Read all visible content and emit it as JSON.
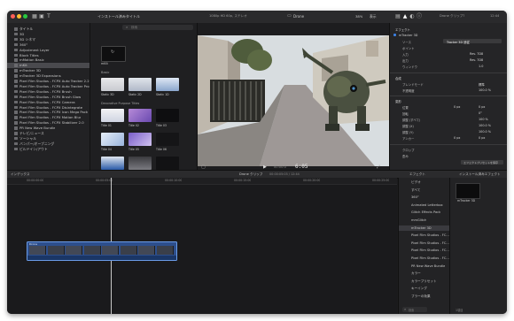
{
  "toolbar": {
    "title_center": "インストール済みタイトル",
    "viewer_info": "1080p HD 60p, ステレオ",
    "viewer_name": "Drone",
    "zoom": "38%",
    "display": "表示",
    "inspector_title": "Drone クリップ?",
    "inspector_duration": "12:44"
  },
  "sidebar": {
    "items": [
      {
        "label": "タイトル",
        "selected": false
      },
      {
        "label": "3D",
        "selected": false
      },
      {
        "label": "3D シネマ",
        "selected": false
      },
      {
        "label": "360°",
        "selected": false
      },
      {
        "label": "Adjustment Layer",
        "selected": false
      },
      {
        "label": "Block Titles",
        "selected": false
      },
      {
        "label": "mMotion Basic",
        "selected": false
      },
      {
        "label": "mKit",
        "selected": true
      },
      {
        "label": "mTracker 3D",
        "selected": false
      },
      {
        "label": "mTracker 3D Expansions",
        "selected": false
      },
      {
        "label": "Pixel Film Studios - FCPX Auto Tracker 2.2",
        "selected": false
      },
      {
        "label": "Pixel Film Studios - FCPX Auto Tracker Pro",
        "selected": false
      },
      {
        "label": "Pixel Film Studios - FCPX Brush",
        "selected": false
      },
      {
        "label": "Pixel Film Studios - FCPX Brush Glow",
        "selected": false
      },
      {
        "label": "Pixel Film Studios - FCPX Camera",
        "selected": false
      },
      {
        "label": "Pixel Film Studios - FCPX Disintegrate",
        "selected": false
      },
      {
        "label": "Pixel Film Studios - FCPX Icon Mega Pack",
        "selected": false
      },
      {
        "label": "Pixel Film Studios - FCPX Motion Blur",
        "selected": false
      },
      {
        "label": "Pixel Film Studios - FCPX Stabilizer 2.0",
        "selected": false
      },
      {
        "label": "PR New Wave Bundle",
        "selected": false
      },
      {
        "label": "テレビ/ニュース",
        "selected": false
      },
      {
        "label": "ソーシャル",
        "selected": false
      },
      {
        "label": "バンパー/オープニング",
        "selected": false
      },
      {
        "label": "ビルドイン/アウト",
        "selected": false
      }
    ]
  },
  "browser": {
    "search_placeholder": "検索",
    "section_top": "mKit",
    "section_basic": "Basic",
    "basic_items": [
      "Static 3D",
      "Static 2D",
      "Static 1D"
    ],
    "section_titles": "Decorative Purpose Titles",
    "titles_items": [
      "Title 01",
      "Title 02",
      "Title 03",
      "Title 04",
      "Title 05",
      "Title 06"
    ]
  },
  "viewer": {
    "timecode": "6:05",
    "fit": "1:00"
  },
  "inspector": {
    "section_effect": "エフェクト",
    "publish": "パブリッシュ",
    "group_label": "mTracker 3D",
    "rows": [
      {
        "label": "ソース",
        "value": "Tracker 3D 追従"
      },
      {
        "label": "ポイント",
        "value": ""
      },
      {
        "label": "入力",
        "value": "Rev. 7D8"
      },
      {
        "label": "出力",
        "value": "Rev. 7D8"
      },
      {
        "label": "ウィンドウ",
        "value": "1.0"
      }
    ],
    "section_comp": "合成",
    "blend_label": "ブレンドモード",
    "blend_value": "標準",
    "opacity_label": "不透明度",
    "opacity_value": "100.0 %",
    "section_transform": "変形",
    "transform_rows": [
      {
        "label": "位置",
        "x": "0 px",
        "y": "0 px"
      },
      {
        "label": "回転",
        "x": "0°",
        "y": ""
      },
      {
        "label": "調整 (すべて)",
        "x": "100 %",
        "y": ""
      },
      {
        "label": "調整 (X)",
        "x": "100.0 %",
        "y": ""
      },
      {
        "label": "調整 (Y)",
        "x": "100.0 %",
        "y": ""
      },
      {
        "label": "アンカー",
        "x": "0 px",
        "y": "0 px"
      }
    ],
    "crop_label": "クロップ",
    "distort_label": "歪み",
    "save_button": "エフェクトプリセットを保存"
  },
  "timeline_bar": {
    "index_label": "インデックス",
    "clip_name": "Drone クリップ",
    "clip_range": "00:00:05:03 / 12:44",
    "effects_label": "エフェクト",
    "installed_effects": "インストール済みエフェクト"
  },
  "timeline": {
    "ruler": [
      "00:00:00:00",
      "00:00:05:00",
      "00:00:10:00",
      "00:00:15:00",
      "00:00:20:00",
      "00:00:25:00",
      "00:00:30:00",
      "00:00:35:00"
    ],
    "clip_label": "Drone"
  },
  "effects_panel": {
    "categories": [
      {
        "label": "ビデオ",
        "selected": false
      },
      {
        "label": "すべて",
        "selected": false
      },
      {
        "label": "360°",
        "selected": false
      },
      {
        "label": "Animated Letterbox",
        "selected": false
      },
      {
        "label": "Glitch Effects Pack",
        "selected": false
      },
      {
        "label": "mmGlitch",
        "selected": false
      },
      {
        "label": "mTracker 3D",
        "selected": true
      },
      {
        "label": "Pixel Film Studios - FC...",
        "selected": false
      },
      {
        "label": "Pixel Film Studios - FC...",
        "selected": false
      },
      {
        "label": "Pixel Film Studios - FC...",
        "selected": false
      },
      {
        "label": "Pixel Film Studios - FC...",
        "selected": false
      },
      {
        "label": "PR New Wave Bundle",
        "selected": false
      },
      {
        "label": "カラー",
        "selected": false
      },
      {
        "label": "カラープリセット",
        "selected": false
      },
      {
        "label": "キーイング",
        "selected": false
      },
      {
        "label": "ブラーの効果",
        "selected": false
      }
    ],
    "effect_item": "mTracker 3D",
    "search_placeholder": "検索",
    "item_count": "1項目"
  }
}
